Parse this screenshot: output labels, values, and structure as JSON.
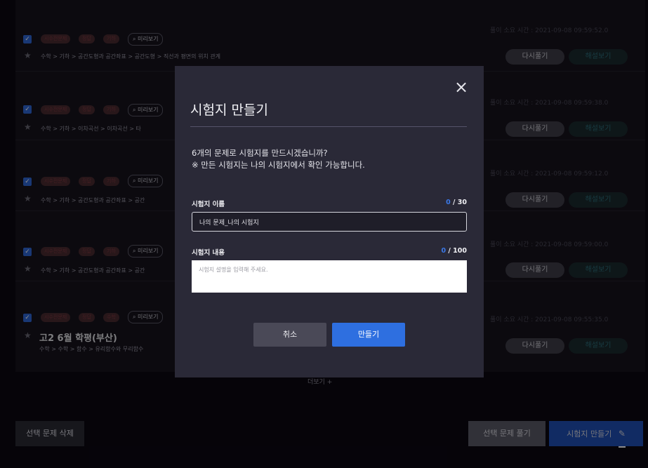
{
  "list": {
    "items": [
      {
        "tags": [
          "시수전문제",
          "정답",
          "기하"
        ],
        "preview": "미리보기",
        "path": "수학 > 기하 > 공간도형과 공간좌표 > 공간도형 > 직선과 평면의 위치 관계",
        "title": "",
        "time_label": "풀이 소요 시간 :   2021-09-08 09:59:52.0",
        "retry": "다시풀기",
        "solution": "해설보기"
      },
      {
        "tags": [
          "시수전문제",
          "정답",
          "기하"
        ],
        "preview": "미리보기",
        "path": "수학 > 기하 > 이차곡선 > 이차곡선 > 타",
        "title": "",
        "time_label": "풀이 소요 시간 :   2021-09-08 09:59:38.0",
        "retry": "다시풀기",
        "solution": "해설보기"
      },
      {
        "tags": [
          "시수전문제",
          "정답",
          "기하"
        ],
        "preview": "미리보기",
        "path": "수학 > 기하 > 공간도형과 공간좌표 > 공간",
        "title": "",
        "time_label": "풀이 소요 시간 :   2021-09-08 09:59:12.0",
        "retry": "다시풀기",
        "solution": "해설보기"
      },
      {
        "tags": [
          "시수전문제",
          "정답",
          "기하"
        ],
        "preview": "미리보기",
        "path": "수학 > 기하 > 공간도형과 공간좌표 > 공간",
        "title": "",
        "time_label": "풀이 소요 시간 :   2021-09-08 09:59:00.0",
        "retry": "다시풀기",
        "solution": "해설보기"
      },
      {
        "tags": [
          "시수전문제",
          "정답",
          "수학"
        ],
        "preview": "미리보기",
        "path": "수학 > 수학 > 함수 > 유리함수와 무리함수",
        "title": "고2 6월 학평(부산)",
        "time_label": "풀이 소요 시간 :   2021-09-08 09:55:35.0",
        "retry": "다시풀기",
        "solution": "해설보기"
      }
    ],
    "more": "더보기 +"
  },
  "bottom": {
    "delete_selected": "선택 문제 삭제",
    "solve_selected": "선택 문제 풀기",
    "make_exam": "시험지 만들기"
  },
  "modal": {
    "title": "시험지 만들기",
    "close": "×",
    "message_line1": "6개의 문제로 시험지를 만드시겠습니까?",
    "message_line2": "※ 만든 시험지는 나의 시험지에서 확인 가능합니다.",
    "name_label": "시험지 이름",
    "name_count": "0",
    "name_max": " / 30",
    "name_value": "나의 문제_나의 시험지",
    "desc_label": "시험지 내용",
    "desc_count": "0",
    "desc_max": " / 100",
    "desc_placeholder": "시험지 설명을 입력해 주세요.",
    "cancel": "취소",
    "create": "만들기"
  },
  "colors": {
    "accent": "#2e6fe0",
    "modal_bg": "#2a2937",
    "page_bg": "#0b0812"
  },
  "icons": {
    "check": "check-icon",
    "star": "star-icon",
    "search": "search-icon",
    "pencil": "pencil-icon",
    "close": "close-icon"
  }
}
